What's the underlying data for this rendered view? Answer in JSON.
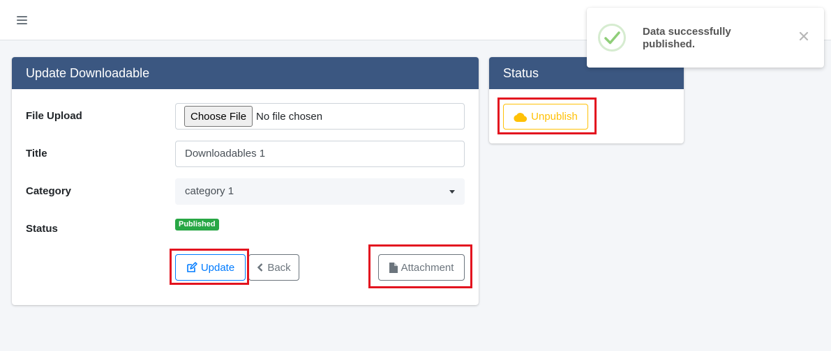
{
  "topbar": {
    "menu_icon": "hamburger-menu-icon"
  },
  "main_card": {
    "title": "Update Downloadable",
    "labels": {
      "file_upload": "File Upload",
      "title": "Title",
      "category": "Category",
      "status": "Status"
    },
    "file_upload": {
      "button_label": "Choose File",
      "file_text": "No file chosen"
    },
    "title_value": "Downloadables 1",
    "category_value": "category 1",
    "status_badge": "Published",
    "buttons": {
      "update": "Update",
      "back": "Back",
      "attachment": "Attachment"
    }
  },
  "status_card": {
    "title": "Status",
    "unpublish_label": "Unpublish"
  },
  "toast": {
    "message": "Data successfully published.",
    "icon": "check-circle-icon",
    "close_icon": "close-icon"
  },
  "colors": {
    "header_bg": "#3b5781",
    "primary": "#007bff",
    "secondary": "#6c757d",
    "warning": "#ffc107",
    "success": "#28a745",
    "highlight": "#e3141f"
  }
}
